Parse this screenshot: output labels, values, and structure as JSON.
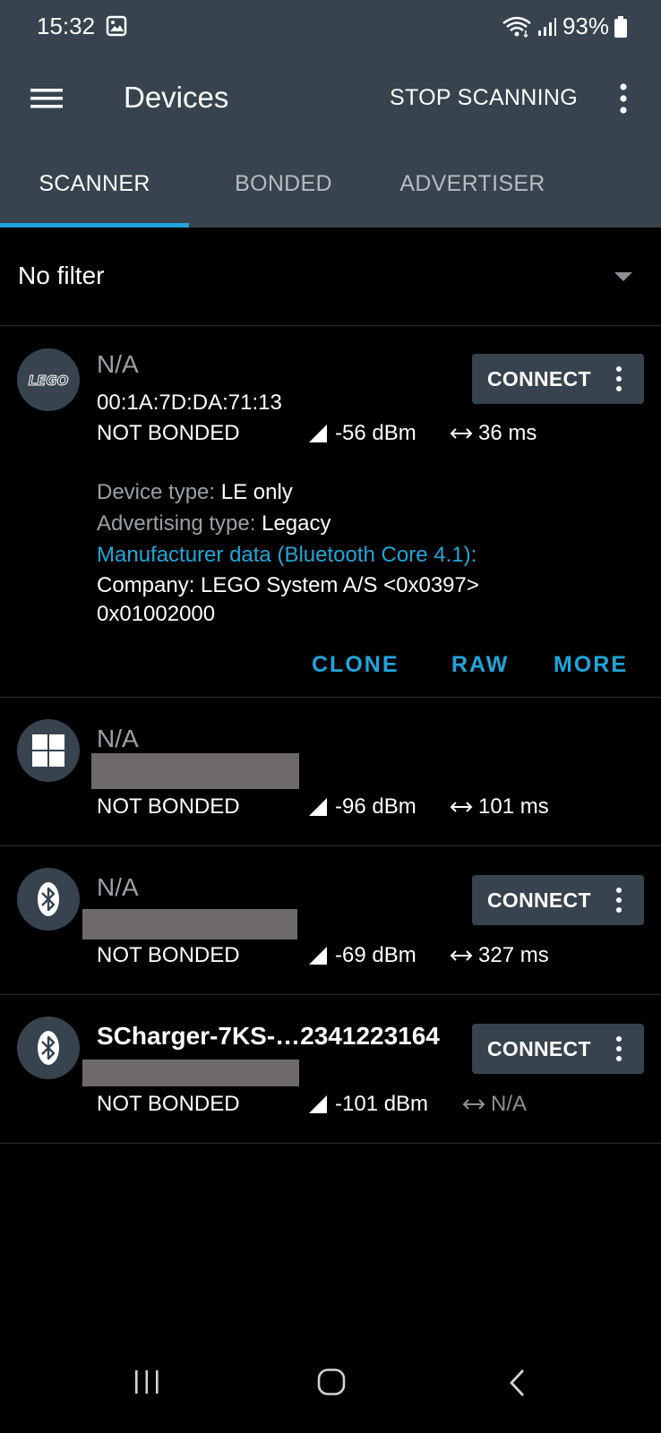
{
  "status_bar": {
    "time": "15:32",
    "battery": "93%",
    "icons": [
      "image-icon",
      "wifi-icon",
      "signal-icon",
      "battery-icon"
    ]
  },
  "app_bar": {
    "title": "Devices",
    "stop_scanning": "STOP SCANNING"
  },
  "tabs": [
    {
      "label": "SCANNER",
      "active": true
    },
    {
      "label": "BONDED",
      "active": false
    },
    {
      "label": "ADVERTISER",
      "active": false
    }
  ],
  "filter": {
    "label": "No filter"
  },
  "devices": [
    {
      "avatar": "LEGO",
      "name": "N/A",
      "address": "00:1A:7D:DA:71:13",
      "bond": "NOT BONDED",
      "rssi": "-56 dBm",
      "interval": "36 ms",
      "connect_label": "CONNECT",
      "device_type_label": "Device type:",
      "device_type_value": "LE only",
      "adv_type_label": "Advertising type:",
      "adv_type_value": "Legacy",
      "manufacturer_title": "Manufacturer data (Bluetooth Core 4.1):",
      "company": "Company: LEGO System A/S <0x0397>",
      "data": "0x01002000",
      "actions": [
        "CLONE",
        "RAW",
        "MORE"
      ]
    },
    {
      "avatar": "windows-icon",
      "name": "N/A",
      "bond": "NOT BONDED",
      "rssi": "-96 dBm",
      "interval": "101 ms"
    },
    {
      "avatar": "bluetooth-icon",
      "name": "N/A",
      "bond": "NOT BONDED",
      "rssi": "-69 dBm",
      "interval": "327 ms",
      "connect_label": "CONNECT"
    },
    {
      "avatar": "bluetooth-icon",
      "name": "SCharger-7KS-…2341223164",
      "bond": "NOT BONDED",
      "rssi": "-101 dBm",
      "interval": "N/A",
      "connect_label": "CONNECT"
    }
  ],
  "colors": {
    "header": "#37434e",
    "accent": "#1ea6da",
    "background": "#000000",
    "muted": "#9aa0a6",
    "redaction": "#6e6a6a"
  }
}
